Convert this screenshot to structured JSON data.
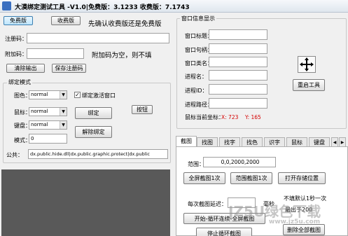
{
  "window": {
    "title": "大漠绑定测试工具 -V1.0|免费版：3.1233 收费版：7.1743"
  },
  "version_buttons": {
    "free": "免费版",
    "paid": "收费版",
    "hint": "先确认收费版还是免费版"
  },
  "registration": {
    "reg_code_label": "注册码：",
    "reg_code_value": "",
    "extra_code_label": "附加码：",
    "extra_code_value": "",
    "extra_hint": "附加码为空，则不填",
    "clear_output": "清除输出",
    "save_reg": "保存注册码"
  },
  "bind_mode": {
    "group_title": "绑定模式",
    "display_label": "图色：",
    "display_value": "normal",
    "mouse_label": "鼠标：",
    "mouse_value": "normal",
    "keypad_label": "键盘：",
    "keypad_value": "normal",
    "mode_label": "模式：",
    "mode_value": "0",
    "activate_checkbox": "绑定激活窗口",
    "activate_checked": true,
    "bind_button": "绑定",
    "unbind_button": "解除绑定",
    "key_button": "按钮",
    "public_label": "公共：",
    "public_value": "dx.public.hide.dll|dx.public.graphic.protect|dx.public"
  },
  "window_info": {
    "group_title": "窗口信息显示",
    "handle_label": "窗口标题：",
    "handle_value": "",
    "handle2_label": "窗口句柄：",
    "handle2_value": "",
    "class_label": "窗口类名：",
    "class_value": "",
    "process_label": "进程名：",
    "process_value": "",
    "pid_label": "进程ID：",
    "pid_value": "",
    "path_label": "进程路径：",
    "path_value": "",
    "mouse_pos_label": "鼠标当前坐标：",
    "mouse_x": "X:  723",
    "mouse_y": "Y:  165",
    "reset_button": "重启工具",
    "crosshair_icon": "crosshair-icon"
  },
  "tabs": [
    {
      "label": "截图"
    },
    {
      "label": "找图"
    },
    {
      "label": "找字"
    },
    {
      "label": "找色"
    },
    {
      "label": "识字"
    },
    {
      "label": "鼠标"
    },
    {
      "label": "键盘"
    }
  ],
  "screenshot_tab": {
    "range_label": "范围：",
    "range_value": "0,0,2000,2000",
    "full_shot": "全屏截图1次",
    "range_shot": "范围截图1次",
    "open_dir": "打开存储位置",
    "delay_label": "每次截图延迟：",
    "delay_value": "",
    "delay_unit": "毫秒",
    "delay_hint1": "不填默认1秒一次",
    "delay_hint2": "最出于200",
    "loop_button": "开始-循环连续-全屏截图",
    "stop_button": "停止循环截图",
    "clear_button": "删除全部截图"
  },
  "watermark": {
    "line1": "JZ5U绿色下载",
    "line2": "www.jz5u.com"
  }
}
